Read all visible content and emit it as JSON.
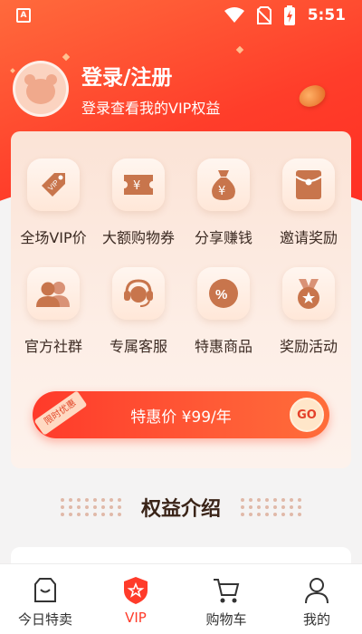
{
  "status_bar": {
    "time": "5:51",
    "app_badge": "A"
  },
  "user": {
    "login_title": "登录/注册",
    "login_subtitle": "登录查看我的VIP权益"
  },
  "benefits": [
    {
      "label": "全场VIP价",
      "icon": "vip-tag-icon"
    },
    {
      "label": "大额购物券",
      "icon": "coupon-icon"
    },
    {
      "label": "分享赚钱",
      "icon": "money-bag-icon"
    },
    {
      "label": "邀请奖励",
      "icon": "red-envelope-icon"
    },
    {
      "label": "官方社群",
      "icon": "group-icon"
    },
    {
      "label": "专属客服",
      "icon": "customer-service-icon"
    },
    {
      "label": "特惠商品",
      "icon": "discount-icon"
    },
    {
      "label": "奖励活动",
      "icon": "medal-icon"
    }
  ],
  "promo": {
    "tag": "限时优惠",
    "text": "特惠价 ¥99/年",
    "go": "GO"
  },
  "section": {
    "title": "权益介绍"
  },
  "tabs": [
    {
      "label": "今日特卖",
      "icon": "shop-icon"
    },
    {
      "label": "VIP",
      "icon": "vip-shield-icon",
      "active": true
    },
    {
      "label": "购物车",
      "icon": "cart-icon"
    },
    {
      "label": "我的",
      "icon": "profile-icon"
    }
  ],
  "colors": {
    "accent": "#ff3b2a",
    "icon_brown": "#c47048"
  }
}
